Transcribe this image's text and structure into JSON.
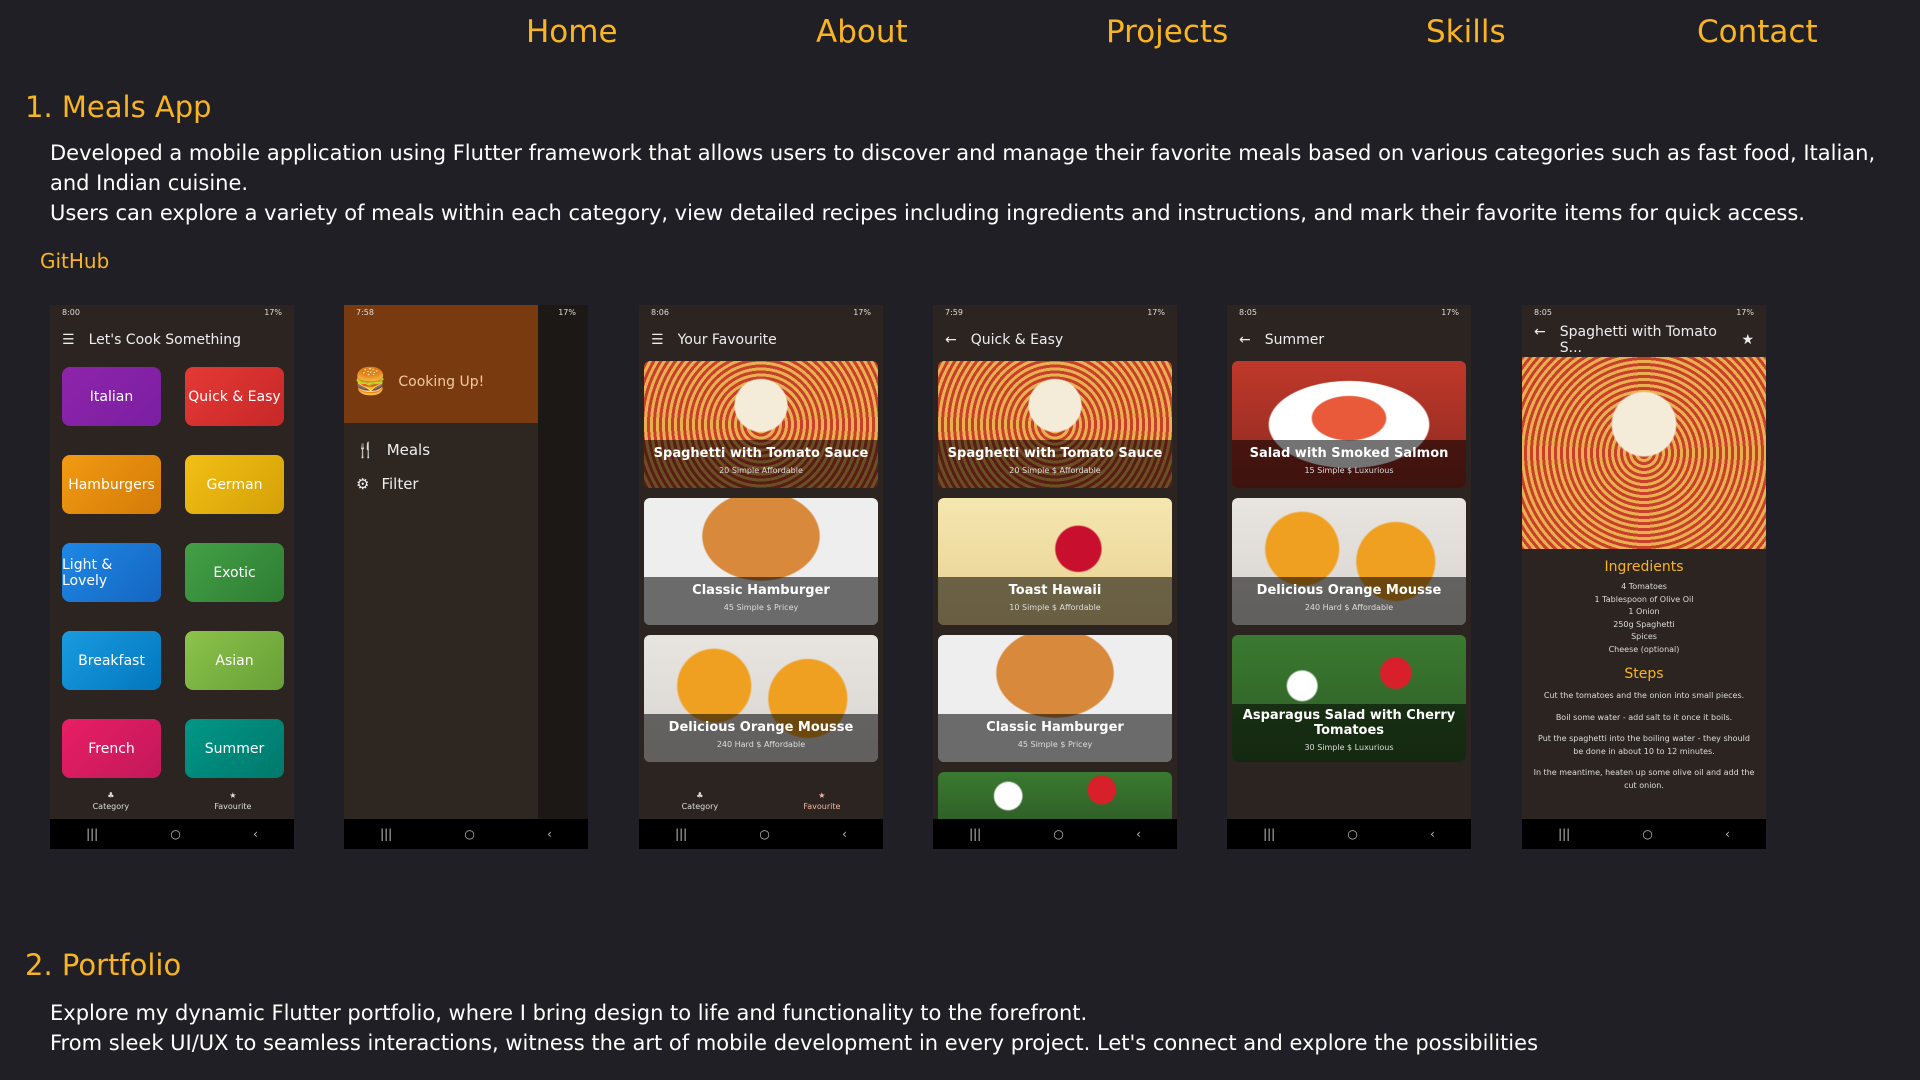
{
  "nav": {
    "home": "Home",
    "about": "About",
    "projects": "Projects",
    "skills": "Skills",
    "contact": "Contact"
  },
  "project1": {
    "title": "1. Meals App",
    "desc_line1": "Developed a mobile application using Flutter framework that allows users to discover and manage their favorite meals  based on various categories such as fast food, Italian, and Indian cuisine.",
    "desc_line2": "Users can explore a variety of meals within each category, view detailed recipes including ingredients and instructions, and mark their favorite items for quick access.",
    "github": "GitHub"
  },
  "screens": {
    "s1": {
      "status_time": "8:00",
      "status_right": "17%",
      "title": "Let's Cook Something",
      "tiles": [
        "Italian",
        "Quick & Easy",
        "Hamburgers",
        "German",
        "Light & Lovely",
        "Exotic",
        "Breakfast",
        "Asian",
        "French",
        "Summer"
      ],
      "nav_category": "Category",
      "nav_favourite": "Favourite"
    },
    "s2": {
      "status_time": "7:58",
      "status_right": "17%",
      "drawer_title": "Cooking Up!",
      "meals": "Meals",
      "filter": "Filter"
    },
    "s3": {
      "status_time": "8:06",
      "status_right": "17%",
      "title": "Your Favourite",
      "cards": [
        {
          "title": "Spaghetti with Tomato Sauce",
          "meta": "20   Simple   Affordable"
        },
        {
          "title": "Classic Hamburger",
          "meta": "45   Simple $  Pricey"
        },
        {
          "title": "Delicious Orange Mousse",
          "meta": "240   Hard $  Affordable"
        }
      ],
      "nav_category": "Category",
      "nav_favourite": "Favourite"
    },
    "s4": {
      "status_time": "7:59",
      "status_right": "17%",
      "title": "Quick & Easy",
      "cards": [
        {
          "title": "Spaghetti with Tomato Sauce",
          "meta": "20   Simple $  Affordable"
        },
        {
          "title": "Toast Hawaii",
          "meta": "10   Simple $  Affordable"
        },
        {
          "title": "Classic Hamburger",
          "meta": "45   Simple $  Pricey"
        }
      ]
    },
    "s5": {
      "status_time": "8:05",
      "status_right": "17%",
      "title": "Summer",
      "cards": [
        {
          "title": "Salad with Smoked Salmon",
          "meta": "15   Simple $  Luxurious"
        },
        {
          "title": "Delicious Orange Mousse",
          "meta": "240   Hard $  Affordable"
        },
        {
          "title": "Asparagus Salad with Cherry Tomatoes",
          "meta": "30   Simple $  Luxurious"
        }
      ]
    },
    "s6": {
      "status_time": "8:05",
      "status_right": "17%",
      "title": "Spaghetti with Tomato S...",
      "ingredients_h": "Ingredients",
      "ingredients": [
        "4 Tomatoes",
        "1 Tablespoon of Olive Oil",
        "1 Onion",
        "250g Spaghetti",
        "Spices",
        "Cheese (optional)"
      ],
      "steps_h": "Steps",
      "steps": [
        "Cut the tomatoes and the onion into small pieces.",
        "Boil some water - add salt to it once it boils.",
        "Put the spaghetti into the boiling water - they should be done in about 10 to 12 minutes.",
        "In the meantime, heaten up some olive oil and add the cut onion."
      ]
    }
  },
  "project2": {
    "title": "2. Portfolio",
    "desc_line1": "Explore my dynamic Flutter portfolio, where I bring design to life and functionality to the forefront.",
    "desc_line2": "From sleek UI/UX to seamless interactions, witness the art of mobile development in every project. Let's connect and explore the possibilities"
  },
  "colors": {
    "accent": "#f9b521",
    "bg": "#201f25"
  }
}
